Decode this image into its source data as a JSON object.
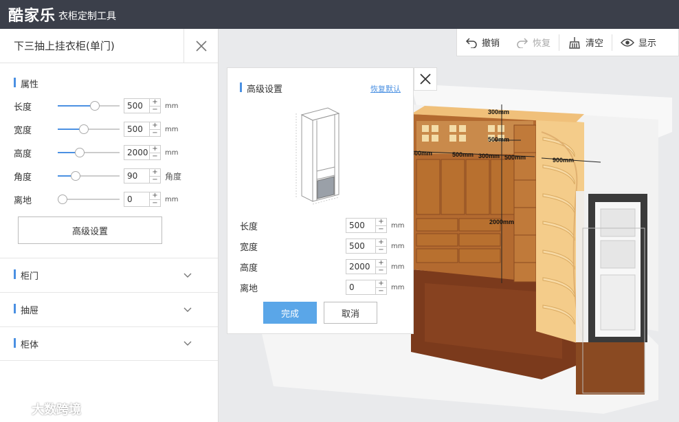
{
  "app": {
    "brand": "酷家乐",
    "subtitle": "衣柜定制工具"
  },
  "left_panel": {
    "title": "下三抽上挂衣柜(单门)",
    "properties_label": "属性",
    "properties": [
      {
        "name": "长度",
        "value": "500",
        "unit": "mm",
        "level": 0.6
      },
      {
        "name": "宽度",
        "value": "500",
        "unit": "mm",
        "level": 0.42
      },
      {
        "name": "高度",
        "value": "2000",
        "unit": "mm",
        "level": 0.36
      },
      {
        "name": "角度",
        "value": "90",
        "unit": "角度",
        "level": 0.29
      },
      {
        "name": "离地",
        "value": "0",
        "unit": "mm",
        "level": 0.0
      }
    ],
    "advanced_button": "高级设置",
    "sections": [
      "柜门",
      "抽屉",
      "柜体"
    ]
  },
  "toolbar": {
    "undo": "撤销",
    "redo": "恢复",
    "clear": "清空",
    "show": "显示"
  },
  "dialog": {
    "title": "高级设置",
    "reset": "恢复默认",
    "fields": [
      {
        "name": "长度",
        "value": "500",
        "unit": "mm"
      },
      {
        "name": "宽度",
        "value": "500",
        "unit": "mm"
      },
      {
        "name": "高度",
        "value": "2000",
        "unit": "mm"
      },
      {
        "name": "离地",
        "value": "0",
        "unit": "mm"
      }
    ],
    "confirm": "完成",
    "cancel": "取消"
  },
  "scene_dimensions": {
    "top": "300mm",
    "a": "300mm",
    "b": "500mm",
    "c": "300mm",
    "d": "500mm",
    "e": "500mm",
    "right": "900mm",
    "height": "2000mm"
  },
  "watermark": "大数跨境",
  "colors": {
    "topbar": "#3b3f4a",
    "accent": "#4a90e2",
    "primary_button": "#5aa6e8"
  }
}
